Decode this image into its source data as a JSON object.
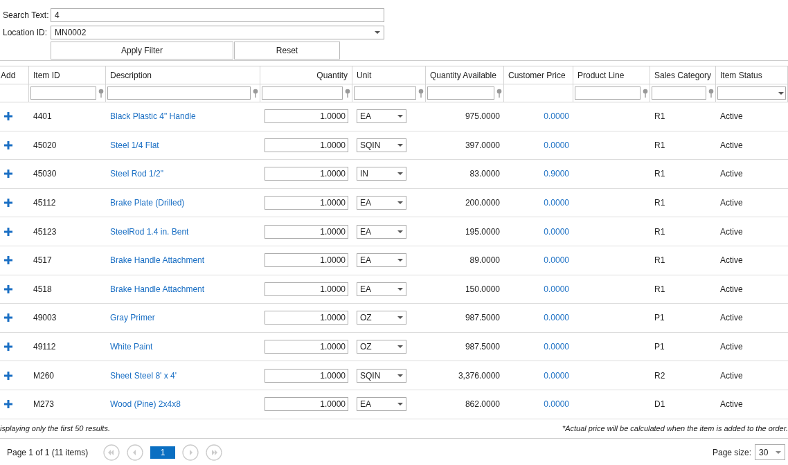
{
  "filter_form": {
    "search_text": {
      "label": "Search Text:",
      "value": "4"
    },
    "location_id": {
      "label": "Location ID:",
      "value": "MN0002"
    },
    "buttons": [
      "Apply Filter",
      "Reset"
    ]
  },
  "table": {
    "columns": [
      {
        "label": "Add",
        "kind": "plain"
      },
      {
        "label": "Item ID",
        "kind": "text"
      },
      {
        "label": "Description",
        "kind": "text"
      },
      {
        "label": "Quantity",
        "kind": "numeric"
      },
      {
        "label": "Unit",
        "kind": "text"
      },
      {
        "label": "Quantity Available",
        "kind": "text"
      },
      {
        "label": "Customer Price",
        "kind": "plain"
      },
      {
        "label": "Product Line",
        "kind": "text"
      },
      {
        "label": "Sales Category",
        "kind": "text"
      },
      {
        "label": "Item Status",
        "kind": "dropdown"
      }
    ],
    "rows": [
      {
        "item_id": "4401",
        "description": "Black Plastic 4\" Handle",
        "quantity": "1.0000",
        "unit": "EA",
        "quantity_available": "975.0000",
        "customer_price": "0.0000",
        "sales_category": "R1",
        "item_status": "Active"
      },
      {
        "item_id": "45020",
        "description": "Steel 1/4 Flat",
        "quantity": "1.0000",
        "unit": "SQIN",
        "quantity_available": "397.0000",
        "customer_price": "0.0000",
        "sales_category": "R1",
        "item_status": "Active"
      },
      {
        "item_id": "45030",
        "description": "Steel Rod 1/2\"",
        "quantity": "1.0000",
        "unit": "IN",
        "quantity_available": "83.0000",
        "customer_price": "0.9000",
        "sales_category": "R1",
        "item_status": "Active"
      },
      {
        "item_id": "45112",
        "description": "Brake Plate (Drilled)",
        "quantity": "1.0000",
        "unit": "EA",
        "quantity_available": "200.0000",
        "customer_price": "0.0000",
        "sales_category": "R1",
        "item_status": "Active"
      },
      {
        "item_id": "45123",
        "description": "SteelRod 1.4 in. Bent",
        "quantity": "1.0000",
        "unit": "EA",
        "quantity_available": "195.0000",
        "customer_price": "0.0000",
        "sales_category": "R1",
        "item_status": "Active"
      },
      {
        "item_id": "4517",
        "description": "Brake Handle Attachment",
        "quantity": "1.0000",
        "unit": "EA",
        "quantity_available": "89.0000",
        "customer_price": "0.0000",
        "sales_category": "R1",
        "item_status": "Active"
      },
      {
        "item_id": "4518",
        "description": "Brake Handle Attachment",
        "quantity": "1.0000",
        "unit": "EA",
        "quantity_available": "150.0000",
        "customer_price": "0.0000",
        "sales_category": "R1",
        "item_status": "Active"
      },
      {
        "item_id": "49003",
        "description": "Gray Primer",
        "quantity": "1.0000",
        "unit": "OZ",
        "quantity_available": "987.5000",
        "customer_price": "0.0000",
        "sales_category": "P1",
        "item_status": "Active"
      },
      {
        "item_id": "49112",
        "description": "White Paint",
        "quantity": "1.0000",
        "unit": "OZ",
        "quantity_available": "987.5000",
        "customer_price": "0.0000",
        "sales_category": "P1",
        "item_status": "Active"
      },
      {
        "item_id": "M260",
        "description": "Sheet Steel 8' x 4'",
        "quantity": "1.0000",
        "unit": "SQIN",
        "quantity_available": "3,376.0000",
        "customer_price": "0.0000",
        "sales_category": "R2",
        "item_status": "Active"
      },
      {
        "item_id": "M273",
        "description": "Wood (Pine) 2x4x8",
        "quantity": "1.0000",
        "unit": "EA",
        "quantity_available": "862.0000",
        "customer_price": "0.0000",
        "sales_category": "D1",
        "item_status": "Active"
      }
    ]
  },
  "notes": {
    "left": "isplaying only the first 50 results.",
    "right": "*Actual price will be calculated when the item is added to the order."
  },
  "pager": {
    "summary": "Page 1 of 1 (11 items)",
    "nav": [
      {
        "kind": "first",
        "disabled": true
      },
      {
        "kind": "prev",
        "disabled": true
      }
    ],
    "pages": [
      {
        "label": "1",
        "selected": true
      }
    ],
    "nav_after": [
      {
        "kind": "next",
        "disabled": true
      },
      {
        "kind": "last",
        "disabled": true
      }
    ],
    "page_size": {
      "label": "Page size:",
      "value": "30"
    }
  }
}
